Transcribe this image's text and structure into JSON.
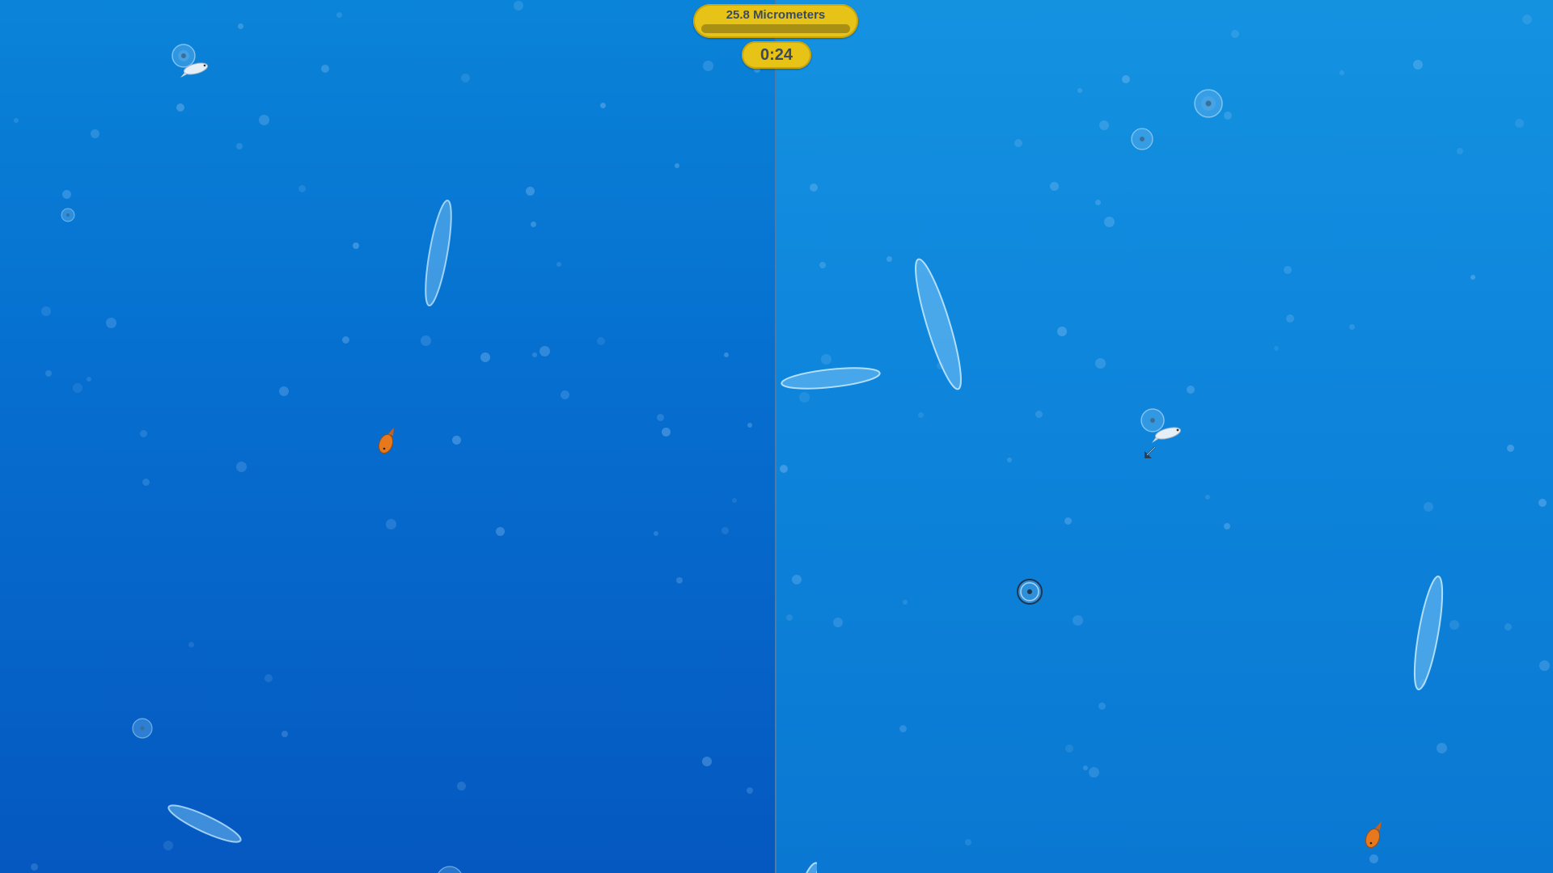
{
  "hud": {
    "size_label": "25.8 Micrometers",
    "size_progress": 0.0,
    "timer": "0:24"
  },
  "colors": {
    "left_water": "#0670d0",
    "right_water": "#0e86dc",
    "hud_yellow": "#e8c317",
    "hud_text": "#3b4a5e",
    "cell_body": "#5cb4ee",
    "fish_orange": "#e8781c"
  },
  "icons": {
    "player_crosshair": "crosshair-ring-icon",
    "direction_arrow": "arrow-down-left-icon",
    "orange_fish": "orange-fish-icon",
    "white_fish": "white-fish-icon",
    "paramecium": "paramecium-cell-icon",
    "spore": "spore-cell-icon"
  }
}
